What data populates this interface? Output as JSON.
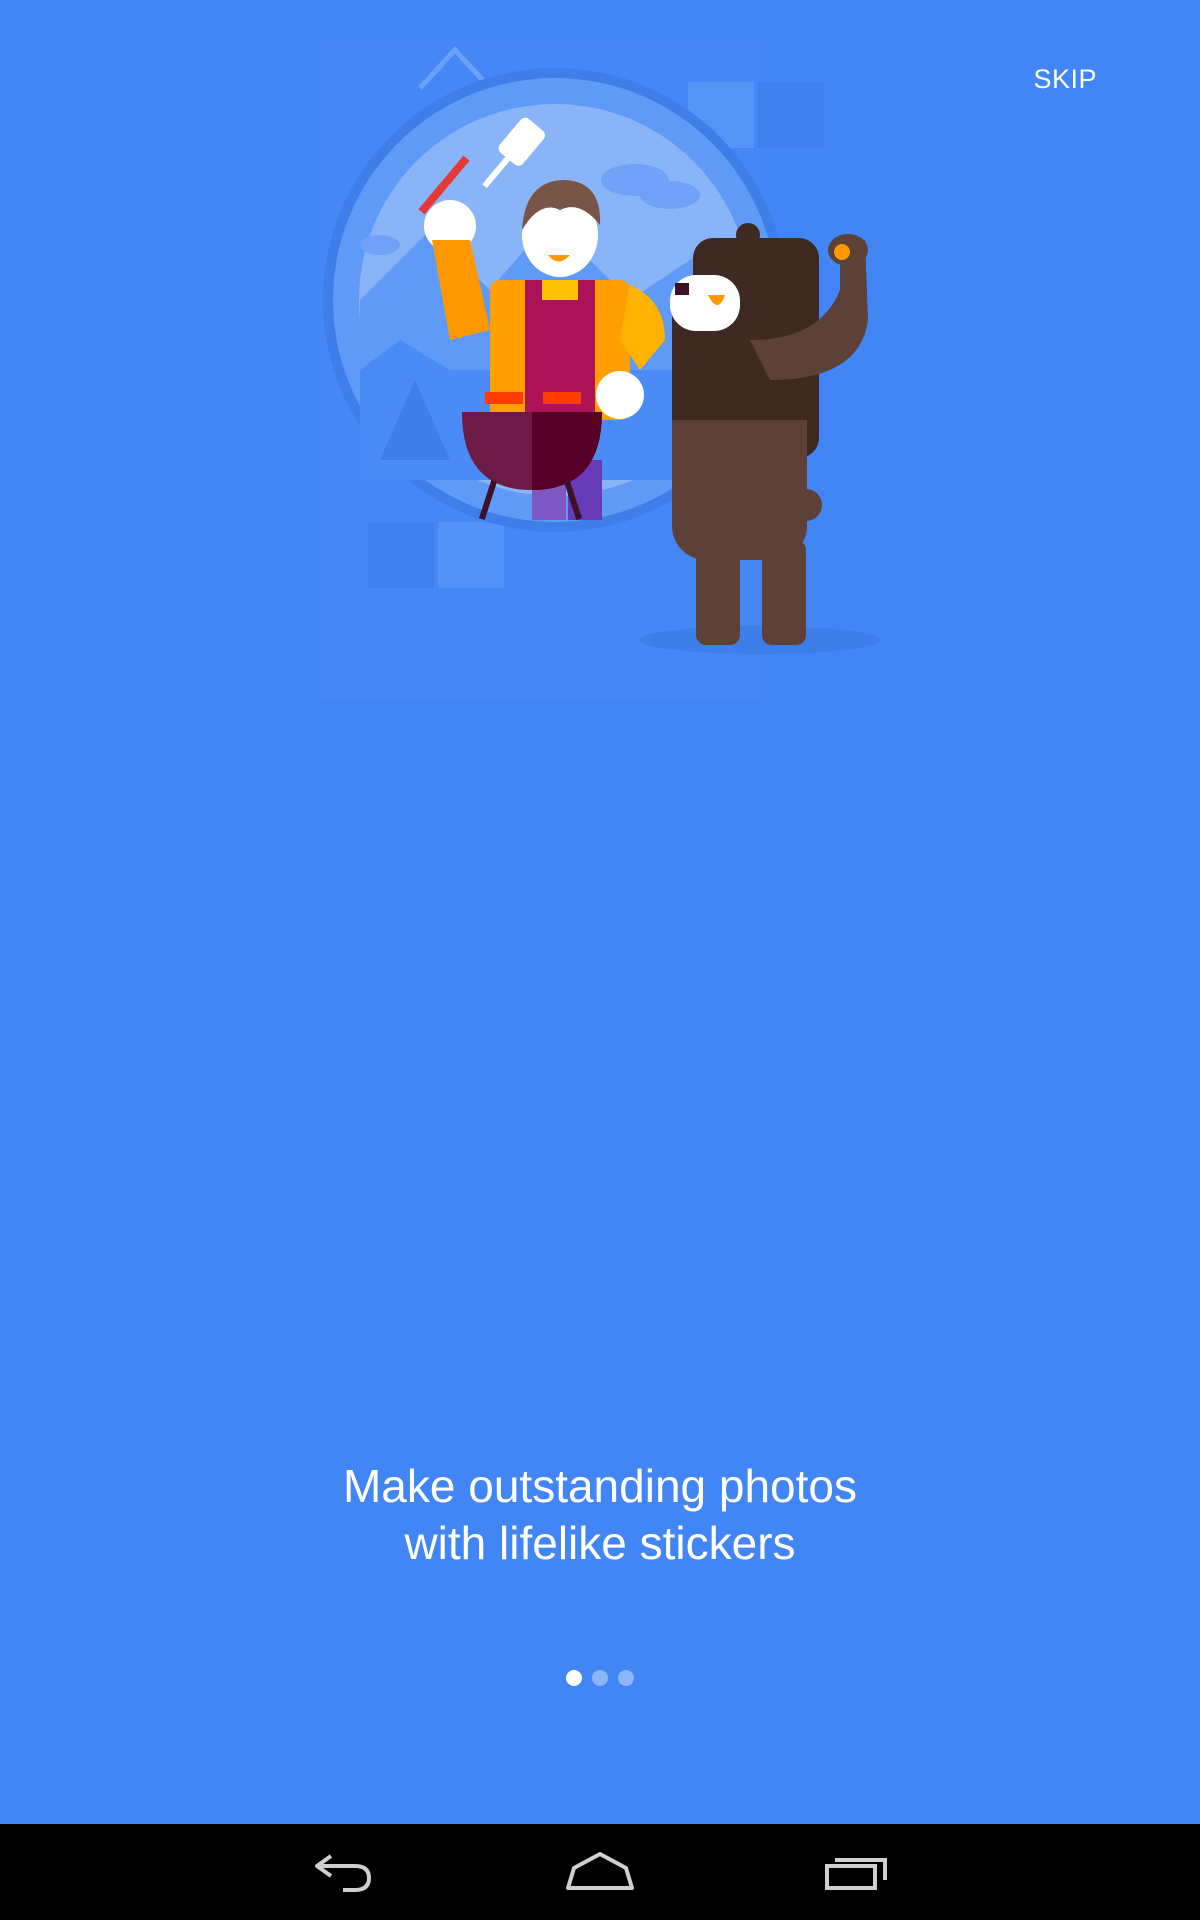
{
  "onboarding": {
    "skip_label": "SKIP",
    "headline": "Make outstanding photos with lifelike stickers",
    "page_count": 3,
    "current_page": 1
  },
  "illustration": {
    "subject": "person grilling with a waving bear sticker"
  },
  "navigation": {
    "back_icon": "back-icon",
    "home_icon": "home-icon",
    "recents_icon": "recents-icon"
  },
  "colors": {
    "background": "#4285f4",
    "text": "#ffffff",
    "navbar": "#000000"
  }
}
